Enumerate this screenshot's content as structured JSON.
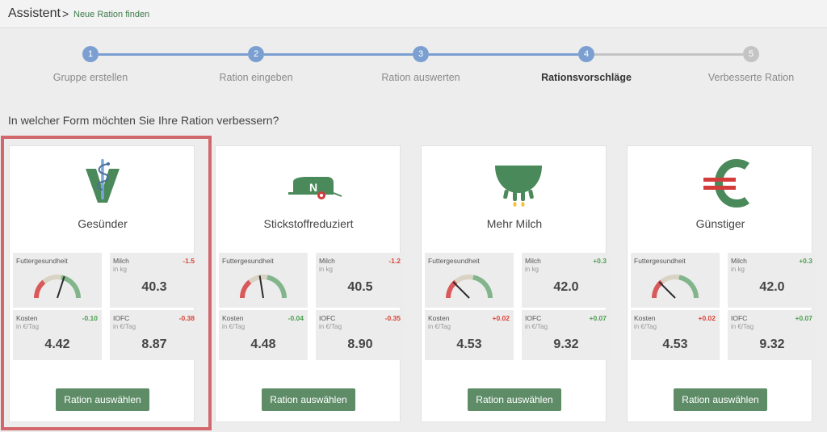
{
  "header": {
    "title": "Assistent",
    "separator": ">",
    "subtitle": "Neue Ration finden"
  },
  "colors": {
    "step_active": "#7b9fd1",
    "step_inactive": "#c4c4c4",
    "button": "#5e8c67",
    "positive": "#4ba04f",
    "negative": "#d9443a",
    "highlight_frame": "#d2676c"
  },
  "steps": [
    {
      "number": "1",
      "label": "Gruppe erstellen",
      "state": "done"
    },
    {
      "number": "2",
      "label": "Ration eingeben",
      "state": "done"
    },
    {
      "number": "3",
      "label": "Ration auswerten",
      "state": "done"
    },
    {
      "number": "4",
      "label": "Rationsvorschläge",
      "state": "current"
    },
    {
      "number": "5",
      "label": "Verbesserte Ration",
      "state": "todo"
    }
  ],
  "question": "In welcher Form möchten Sie Ihre Ration verbessern?",
  "cards": [
    {
      "icon": "vet-health-icon",
      "title": "Gesünder",
      "selected": true,
      "health_label": "Futtergesundheit",
      "health_level": 0.6,
      "milk": {
        "label": "Milch",
        "unit": "in kg",
        "delta": "-1.5",
        "value": "40.3"
      },
      "cost": {
        "label": "Kosten",
        "unit": "in €/Tag",
        "delta": "-0.10",
        "value": "4.42"
      },
      "iofc": {
        "label": "IOFC",
        "unit": "in €/Tag",
        "delta": "-0.38",
        "value": "8.87"
      },
      "button": "Ration auswählen"
    },
    {
      "icon": "nitrogen-spreader-icon",
      "title": "Stickstoffreduziert",
      "selected": false,
      "health_label": "Futtergesundheit",
      "health_level": 0.45,
      "milk": {
        "label": "Milch",
        "unit": "in kg",
        "delta": "-1.2",
        "value": "40.5"
      },
      "cost": {
        "label": "Kosten",
        "unit": "in €/Tag",
        "delta": "-0.04",
        "value": "4.48"
      },
      "iofc": {
        "label": "IOFC",
        "unit": "in €/Tag",
        "delta": "-0.35",
        "value": "8.90"
      },
      "button": "Ration auswählen"
    },
    {
      "icon": "udder-milk-icon",
      "title": "Mehr Milch",
      "selected": false,
      "health_label": "Futtergesundheit",
      "health_level": 0.25,
      "milk": {
        "label": "Milch",
        "unit": "in kg",
        "delta": "+0.3",
        "value": "42.0"
      },
      "cost": {
        "label": "Kosten",
        "unit": "in €/Tag",
        "delta": "+0.02",
        "value": "4.53"
      },
      "iofc": {
        "label": "IOFC",
        "unit": "in €/Tag",
        "delta": "+0.07",
        "value": "9.32"
      },
      "button": "Ration auswählen"
    },
    {
      "icon": "euro-icon",
      "title": "Günstiger",
      "selected": false,
      "health_label": "Futtergesundheit",
      "health_level": 0.25,
      "milk": {
        "label": "Milch",
        "unit": "in kg",
        "delta": "+0.3",
        "value": "42.0"
      },
      "cost": {
        "label": "Kosten",
        "unit": "in €/Tag",
        "delta": "+0.02",
        "value": "4.53"
      },
      "iofc": {
        "label": "IOFC",
        "unit": "in €/Tag",
        "delta": "+0.07",
        "value": "9.32"
      },
      "button": "Ration auswählen"
    }
  ]
}
